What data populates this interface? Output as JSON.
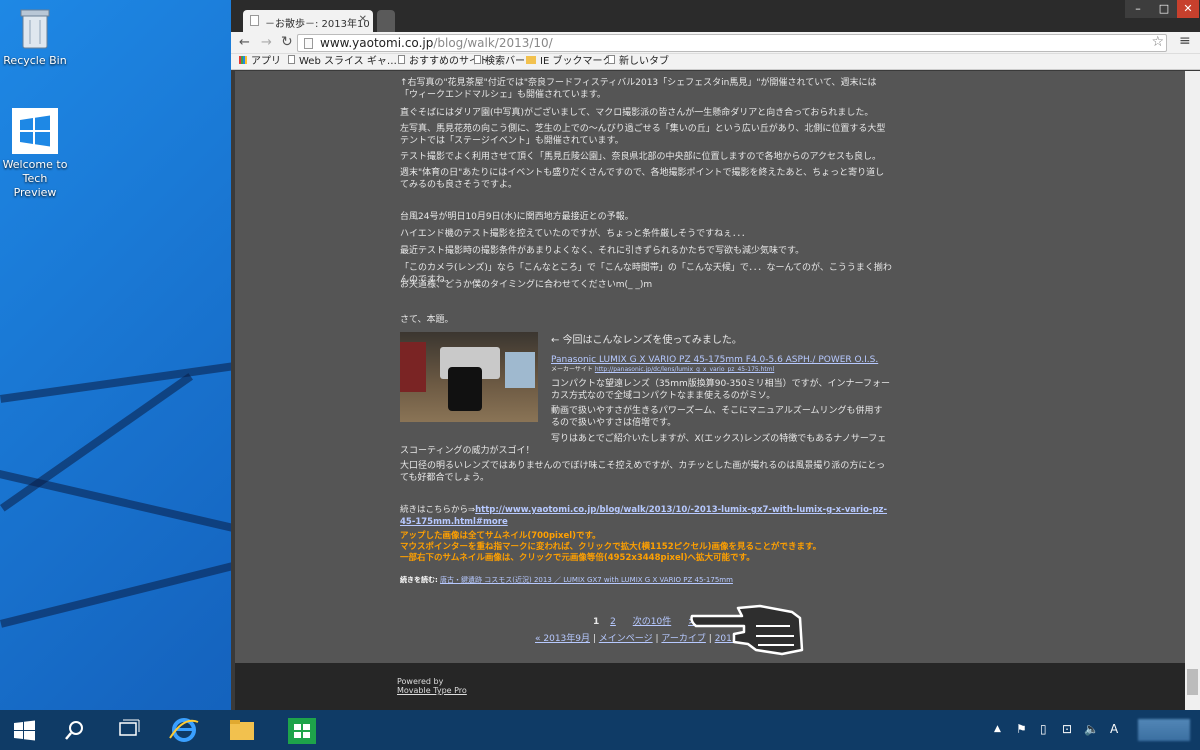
{
  "desktop": {
    "icons": [
      {
        "label": "Recycle Bin"
      },
      {
        "label": "Welcome to Tech Preview"
      }
    ]
  },
  "browser": {
    "tabs": [
      {
        "title": "－お散歩－: 2013年10"
      },
      {
        "title": ""
      }
    ],
    "url_host": "www.yaotomi.co.jp",
    "url_path": "/blog/walk/2013/10/",
    "bookmarks": [
      "アプリ",
      "Web スライス ギャ…",
      "おすすめのサイト",
      "検索バー",
      "IE ブックマーク",
      "新しいタブ"
    ]
  },
  "blog": {
    "p1": "↑右写真の\"花見茶屋\"付近では\"奈良フードフィスティバル2013「シェフェスタin馬見」\"が開催されていて、週末には「ウィークエンドマルシェ」も開催されています。",
    "p2": "直ぐそばにはダリア園(中写真)がございまして、マクロ撮影派の皆さんが一生懸命ダリアと向き合っておられました。",
    "p3": "左写真、馬見花苑の向こう側に、芝生の上での～んびり過ごせる「集いの丘」という広い丘があり、北側に位置する大型テントでは「ステージイベント」も開催されています。",
    "p4": "テスト撮影でよく利用させて頂く「馬見丘陵公園」、奈良県北部の中央部に位置しますので各地からのアクセスも良し。",
    "p5": "週末\"体育の日\"あたりにはイベントも盛りだくさんですので、各地撮影ポイントで撮影を終えたあと、ちょっと寄り道してみるのも良さそうですよ。",
    "p6": "台風24号が明日10月9日(水)に関西地方最接近との予報。",
    "p7": "ハイエンド機のテスト撮影を控えていたのですが、ちょっと条件厳しそうですねぇ．．．",
    "p8": "最近テスト撮影時の撮影条件があまりよくなく、それに引きずられるかたちで写欲も減少気味です。",
    "p9": "「このカメラ(レンズ)」なら「こんなところ」で「こんな時間帯」の「こんな天候」で．．．なーんてのが、こううまく揃わんのですね。",
    "p10": "お天道様、どうか僕のタイミングに合わせてくださいm(_ _)m",
    "p11": "さて、本題。",
    "lens_intro": "← 今回はこんなレンズを使ってみました。",
    "lens_name": "Panasonic LUMIX G X VARIO PZ 45-175mm F4.0-5.6 ASPH./ POWER O.I.S.",
    "maker_label": "メーカーサイト",
    "maker_url": "http://panasonic.jp/dc/lens/lumix_g_x_vario_pz_45-175.html",
    "lens_desc1": "コンパクトな望遠レンズ（35mm版換算90-350ミリ相当）ですが、インナーフォーカス方式なので全域コンパクトなまま使えるのがミソ。",
    "lens_desc2": "動画で扱いやすさが生きるパワーズーム、そこにマニュアルズームリングも併用するので扱いやすさは倍増です。",
    "lens_desc3": "写りはあとでご紹介いたしますが、X(エックス)レンズの特徴でもあるナノサーフェスコーティングの威力がスゴイ！",
    "p12": "大口径の明るいレンズではありませんのでぼけ味こそ控えめですが、カチッとした画が撮れるのは風景撮り派の方にとっても好都合でしょう。",
    "more_label": "続きはこちらから⇒",
    "more_url": "http://www.yaotomi.co.jp/blog/walk/2013/10/-2013-lumix-gx7-with-lumix-g-x-vario-pz-45-175mm.html#more",
    "note1": "アップした画像は全てサムネイル(700pixel)です。",
    "note2": "マウスポインターを重ね指マークに変われば、クリックで拡大(横1152ピクセル)画像を見ることができます。",
    "note3": "一部右下のサムネイル画像は、クリックで元画像等倍(4952x3448pixel)へ拡大可能です。",
    "cont_label": "続きを読む:",
    "cont_link": "唐古・鍵遺跡 コスモス(近況) 2013 ／ LUMIX GX7 with LUMIX G X VARIO PZ 45-175mm",
    "pager": {
      "p1": "1",
      "p2": "2",
      "next": "次の10件",
      "last": ">>"
    },
    "nav": {
      "prev": "« 2013年9月",
      "main": "メインページ",
      "archive": "アーカイブ",
      "next": "2013年11月 »",
      "sep": "|"
    },
    "footer_powered": "Powered by",
    "footer_mt": "Movable Type Pro"
  },
  "taskbar": {
    "ime": "A"
  }
}
